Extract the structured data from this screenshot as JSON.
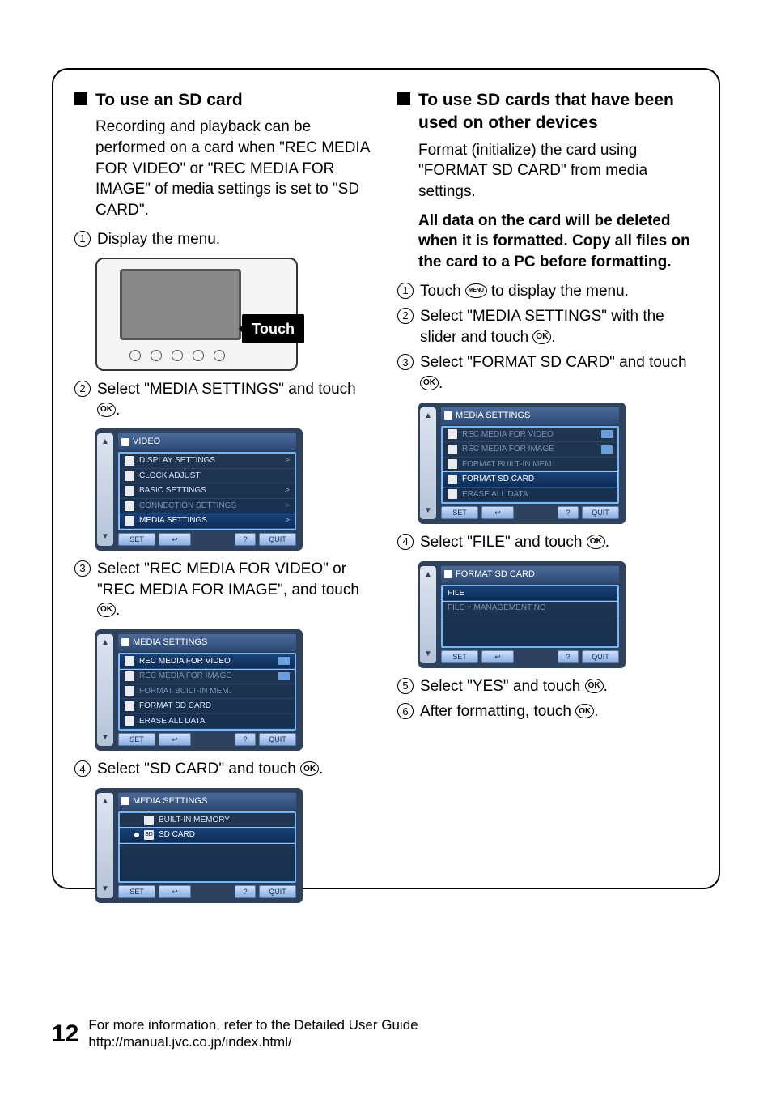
{
  "left": {
    "heading": "To use an SD card",
    "intro": "Recording and playback can be performed on a card when \"REC MEDIA FOR VIDEO\" or \"REC MEDIA FOR IMAGE\" of media settings is set to \"SD CARD\".",
    "step1": "Display the menu.",
    "touch_label": "Touch",
    "step2_a": "Select \"MEDIA SETTINGS\" and touch ",
    "step2_b": ".",
    "menu1": {
      "header": "VIDEO",
      "rows": [
        {
          "label": "DISPLAY SETTINGS",
          "chev": ">"
        },
        {
          "label": "CLOCK ADJUST",
          "chev": ""
        },
        {
          "label": "BASIC SETTINGS",
          "chev": ">"
        },
        {
          "label": "CONNECTION SETTINGS",
          "chev": ">",
          "dim": true
        },
        {
          "label": "MEDIA SETTINGS",
          "chev": ">",
          "hl": true
        }
      ]
    },
    "step3_a": "Select \"REC MEDIA FOR VIDEO\" or \"REC MEDIA FOR IMAGE\", and touch ",
    "step3_b": ".",
    "menu2": {
      "header": "MEDIA SETTINGS",
      "rows": [
        {
          "label": "REC MEDIA FOR VIDEO",
          "tail": true,
          "hl": true
        },
        {
          "label": "REC MEDIA FOR IMAGE",
          "tail": true,
          "dim": true
        },
        {
          "label": "FORMAT BUILT-IN MEM.",
          "dim": true
        },
        {
          "label": "FORMAT SD CARD"
        },
        {
          "label": "ERASE ALL DATA"
        }
      ]
    },
    "step4_a": "Select \"SD CARD\" and touch ",
    "step4_b": ".",
    "menu3": {
      "header": "MEDIA SETTINGS",
      "rows": [
        {
          "label": "BUILT-IN MEMORY",
          "pref_icon": true
        },
        {
          "label": "SD CARD",
          "hl": true,
          "dot": true,
          "pref_icon": true
        }
      ]
    }
  },
  "right": {
    "heading": "To use SD cards that have been used on other devices",
    "intro": "Format (initialize) the card using \"FORMAT SD CARD\" from media settings.",
    "warn": "All data on the card will be deleted when it is formatted. Copy all files on the card to a PC before formatting.",
    "step1_a": "Touch ",
    "step1_b": " to display the menu.",
    "step2_a": "Select \"MEDIA SETTINGS\" with the slider and touch ",
    "step2_b": ".",
    "step3_a": "Select \"FORMAT SD CARD\" and touch ",
    "step3_b": ".",
    "menu1": {
      "header": "MEDIA SETTINGS",
      "rows": [
        {
          "label": "REC MEDIA FOR VIDEO",
          "tail": true,
          "dim": true
        },
        {
          "label": "REC MEDIA FOR IMAGE",
          "tail": true,
          "dim": true
        },
        {
          "label": "FORMAT BUILT-IN MEM.",
          "dim": true
        },
        {
          "label": "FORMAT SD CARD",
          "hl": true
        },
        {
          "label": "ERASE ALL DATA",
          "dim": true
        }
      ]
    },
    "step4_a": "Select \"FILE\" and touch ",
    "step4_b": ".",
    "menu2": {
      "header": "FORMAT SD CARD",
      "rows": [
        {
          "label": "FILE",
          "hl": true
        },
        {
          "label": "FILE + MANAGEMENT NO",
          "dim": true
        }
      ]
    },
    "step5_a": "Select \"YES\" and touch ",
    "step5_b": ".",
    "step6_a": "After formatting, touch ",
    "step6_b": "."
  },
  "icons": {
    "ok": "OK",
    "menu": "MENU"
  },
  "menu_footer": {
    "set": "SET",
    "back": "↩",
    "q": "?",
    "quit": "QUIT"
  },
  "footer": {
    "page": "12",
    "line1": "For more information, refer to the Detailed User Guide",
    "line2": "http://manual.jvc.co.jp/index.html/"
  }
}
